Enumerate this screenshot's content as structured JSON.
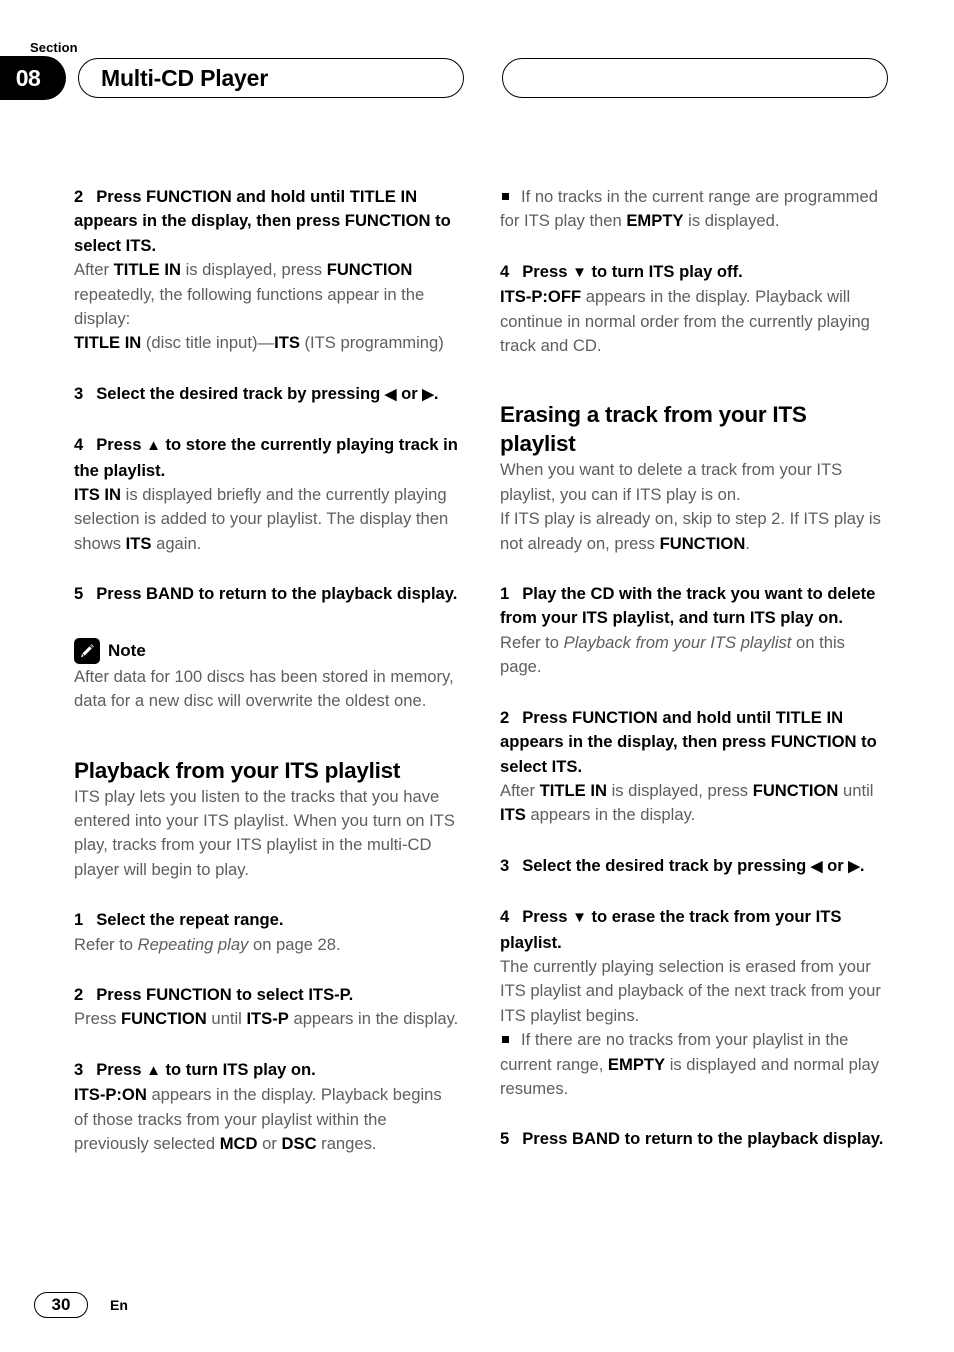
{
  "header": {
    "section_label": "Section",
    "section_number": "08",
    "title": "Multi-CD Player",
    "right_box_text": ""
  },
  "footer": {
    "page_number": "30",
    "language": "En"
  },
  "icons": {
    "note": "pencil-icon",
    "bullet": "square-bullet-icon",
    "left_arrow": "◀",
    "right_arrow": "▶",
    "up_arrow": "▲",
    "down_arrow": "▼"
  },
  "colors": {
    "body_text": "#5e5e5e",
    "emphasis_text": "#000000",
    "accent": "#000000",
    "background": "#ffffff"
  },
  "left_column": {
    "step2": {
      "number": "2",
      "title": "Press FUNCTION and hold until TITLE IN appears in the display, then press FUNCTION to select ITS.",
      "body_line1_a": "After ",
      "body_line1_b": "TITLE IN",
      "body_line1_c": " is displayed, press ",
      "body_line1_d": "FUNCTION",
      "body_line1_e": " repeatedly, the following functions appear in the display:",
      "body_line2_a": "TITLE IN",
      "body_line2_b": " (disc title input)—",
      "body_line2_c": "ITS",
      "body_line2_d": " (ITS programming)"
    },
    "step3": {
      "number": "3",
      "title_a": "Select the desired track by pressing ",
      "title_arrow1": "◀",
      "title_b": " or ",
      "title_arrow2": "▶",
      "title_c": "."
    },
    "step4": {
      "number": "4",
      "title_a": "Press ",
      "title_arrow": "▲",
      "title_b": " to store the currently playing track in the playlist.",
      "body_a": "ITS IN",
      "body_b": " is displayed briefly and the currently playing selection is added to your playlist. The display then shows ",
      "body_c": "ITS",
      "body_d": " again."
    },
    "step5": {
      "number": "5",
      "title": "Press BAND to return to the playback display."
    },
    "note": {
      "label": "Note",
      "text": "After data for 100 discs has been stored in memory, data for a new disc will overwrite the oldest one."
    },
    "playback_section": {
      "heading": "Playback from your ITS playlist",
      "intro": "ITS play lets you listen to the tracks that you have entered into your ITS playlist. When you turn on ITS play, tracks from your ITS playlist in the multi-CD player will begin to play.",
      "step1": {
        "number": "1",
        "title": "Select the repeat range.",
        "body_a": "Refer to ",
        "body_italic": "Repeating play",
        "body_b": " on page 28."
      },
      "step2": {
        "number": "2",
        "title": "Press FUNCTION to select ITS-P.",
        "body_a": "Press ",
        "body_b": "FUNCTION",
        "body_c": " until ",
        "body_d": "ITS-P",
        "body_e": " appears in the display."
      },
      "step3": {
        "number": "3",
        "title_a": "Press ",
        "title_arrow": "▲",
        "title_b": " to turn ITS play on.",
        "body_a": "ITS-P:ON",
        "body_b": " appears in the display. Playback begins of those tracks from your playlist within the previously selected ",
        "body_c": "MCD",
        "body_d": " or ",
        "body_e": "DSC",
        "body_f": " ranges."
      }
    }
  },
  "right_column": {
    "bullet1": {
      "text_a": "If no tracks in the current range are programmed for ITS play then ",
      "text_b": "EMPTY",
      "text_c": " is displayed."
    },
    "step4": {
      "number": "4",
      "title_a": "Press ",
      "title_arrow": "▼",
      "title_b": " to turn ITS play off.",
      "body_a": "ITS-P:OFF",
      "body_b": " appears in the display. Playback will continue in normal order from the currently playing track and CD."
    },
    "erasing_section": {
      "heading": "Erasing a track from your ITS playlist",
      "intro_line1": "When you want to delete a track from your ITS playlist, you can if ITS play is on.",
      "intro_line2_a": "If ITS play is already on, skip to step 2. If ITS play is not already on, press ",
      "intro_line2_b": "FUNCTION",
      "intro_line2_c": ".",
      "step1": {
        "number": "1",
        "title": "Play the CD with the track you want to delete from your ITS playlist, and turn ITS play on.",
        "body_a": "Refer to ",
        "body_italic": "Playback from your ITS playlist",
        "body_b": " on this page."
      },
      "step2": {
        "number": "2",
        "title": "Press FUNCTION and hold until TITLE IN appears in the display, then press FUNCTION to select ITS.",
        "body_a": "After ",
        "body_b": "TITLE IN",
        "body_c": " is displayed, press ",
        "body_d": "FUNCTION",
        "body_e": " until ",
        "body_f": "ITS",
        "body_g": " appears in the display."
      },
      "step3": {
        "number": "3",
        "title_a": "Select the desired track by pressing ",
        "title_arrow1": "◀",
        "title_b": " or ",
        "title_arrow2": "▶",
        "title_c": "."
      },
      "step4": {
        "number": "4",
        "title_a": "Press ",
        "title_arrow": "▼",
        "title_b": " to erase the track from your ITS playlist.",
        "body": "The currently playing selection is erased from your ITS playlist and playback of the next track from your ITS playlist begins.",
        "bullet_a": "If there are no tracks from your playlist in the current range, ",
        "bullet_b": "EMPTY",
        "bullet_c": " is displayed and normal play resumes."
      },
      "step5": {
        "number": "5",
        "title": "Press BAND to return to the playback display."
      }
    }
  }
}
